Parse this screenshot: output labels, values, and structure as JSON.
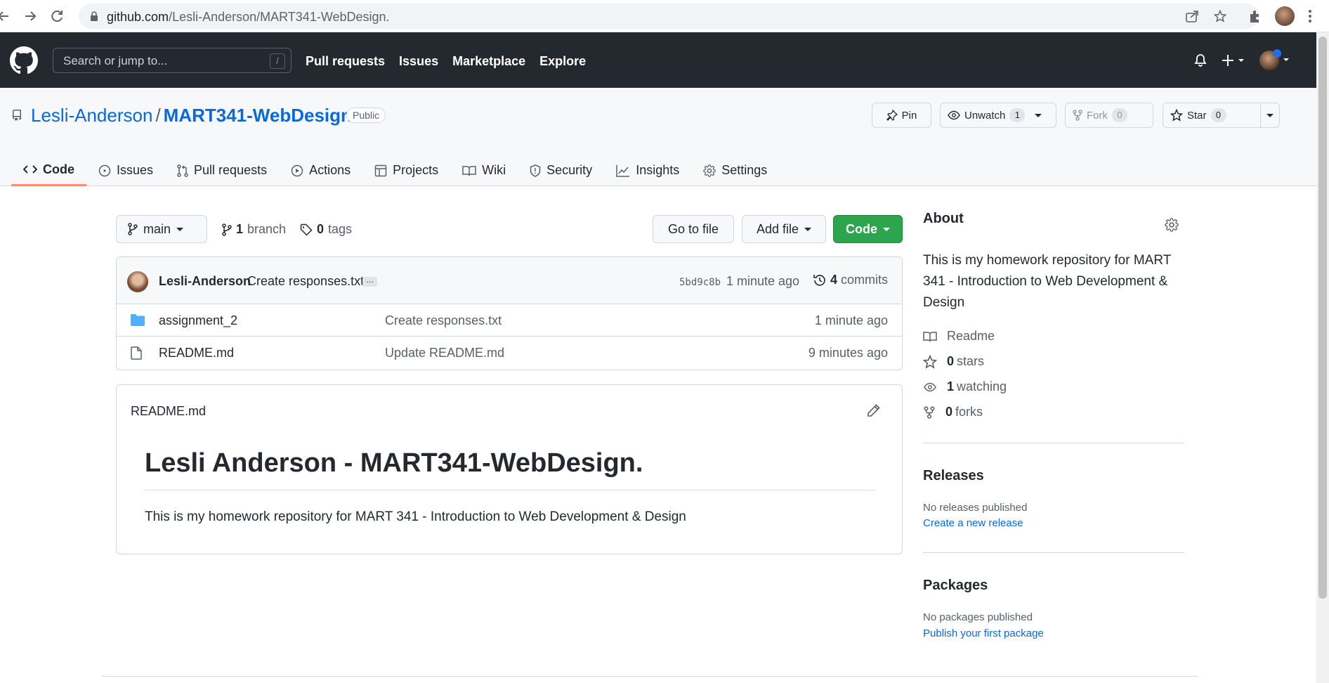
{
  "browser": {
    "url_host": "github.com",
    "url_path": "/Lesli-Anderson/MART341-WebDesign."
  },
  "header": {
    "search_placeholder": "Search or jump to...",
    "search_shortcut": "/",
    "nav": [
      "Pull requests",
      "Issues",
      "Marketplace",
      "Explore"
    ]
  },
  "repo": {
    "owner": "Lesli-Anderson",
    "separator": "/",
    "name": "MART341-WebDesign.",
    "visibility": "Public",
    "pin_label": "Pin",
    "unwatch_label": "Unwatch",
    "watch_count": "1",
    "fork_label": "Fork",
    "fork_count": "0",
    "star_label": "Star",
    "star_count": "0",
    "tabs": [
      "Code",
      "Issues",
      "Pull requests",
      "Actions",
      "Projects",
      "Wiki",
      "Security",
      "Insights",
      "Settings"
    ]
  },
  "toolbar": {
    "branch": "main",
    "branch_count": "1",
    "branch_label": "branch",
    "tag_count": "0",
    "tag_label": "tags",
    "go_to_file": "Go to file",
    "add_file": "Add file",
    "code": "Code"
  },
  "commit": {
    "author": "Lesli-Anderson",
    "message": "Create responses.txt",
    "ellipsis": "…",
    "sha": "5bd9c8b",
    "time": "1 minute ago",
    "commit_count": "4",
    "commits_label": "commits"
  },
  "files": [
    {
      "name": "assignment_2",
      "type": "folder",
      "message": "Create responses.txt",
      "time": "1 minute ago"
    },
    {
      "name": "README.md",
      "type": "file",
      "message": "Update README.md",
      "time": "9 minutes ago"
    }
  ],
  "readme": {
    "filename": "README.md",
    "heading": "Lesli Anderson - MART341-WebDesign.",
    "body": "This is my homework repository for MART 341 - Introduction to Web Development & Design"
  },
  "about": {
    "title": "About",
    "description": "This is my homework repository for MART 341 - Introduction to Web Development & Design",
    "readme_label": "Readme",
    "stars_count": "0",
    "stars_label": "stars",
    "watching_count": "1",
    "watching_label": "watching",
    "forks_count": "0",
    "forks_label": "forks"
  },
  "releases": {
    "title": "Releases",
    "empty": "No releases published",
    "link": "Create a new release"
  },
  "packages": {
    "title": "Packages",
    "empty": "No packages published",
    "link": "Publish your first package"
  },
  "colors": {
    "header_bg": "#24292f",
    "link": "#0969da",
    "code_button": "#2da44e",
    "active_tab_underline": "#fd8c73"
  }
}
